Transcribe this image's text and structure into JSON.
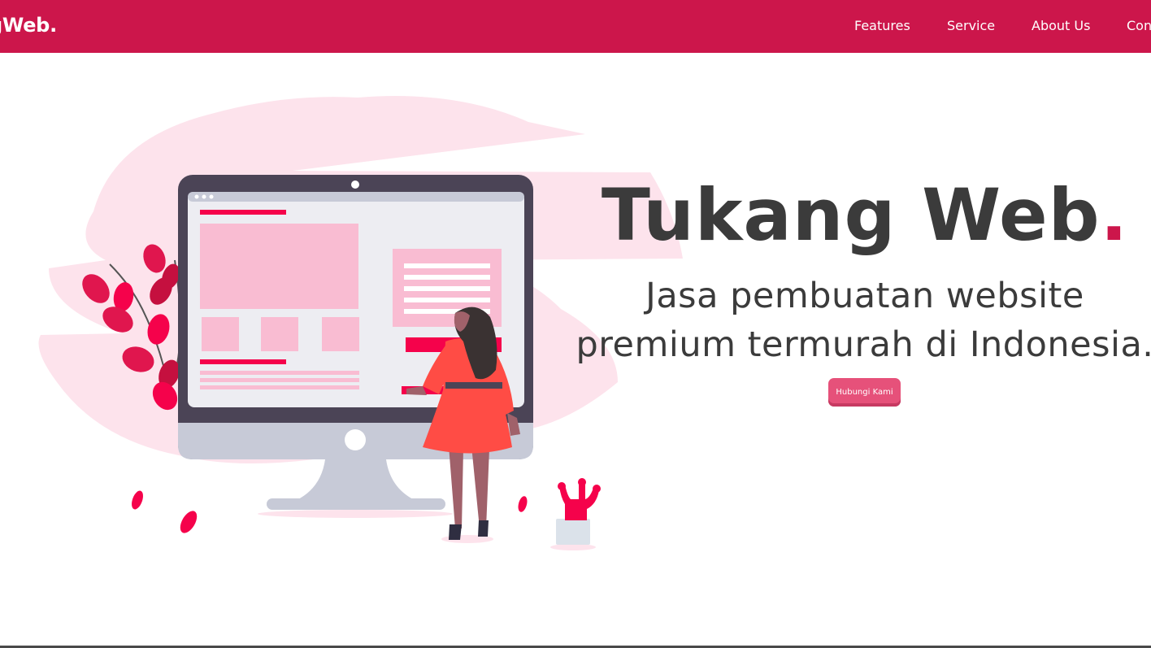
{
  "navbar": {
    "brand_text": "gWeb",
    "brand_dot": ".",
    "items": [
      {
        "label": "Features"
      },
      {
        "label": "Service"
      },
      {
        "label": "About Us"
      },
      {
        "label": "Cont"
      }
    ],
    "background": "#cc164b"
  },
  "hero": {
    "title_main": "Tukang Web",
    "title_dot": ".",
    "subtitle_line1": "Jasa pembuatan website",
    "subtitle_line2": "premium termurah di Indonesia.",
    "cta_label": "Hubungi Kami"
  },
  "colors": {
    "accent": "#cc164b",
    "button": "#e6517a",
    "text": "#3b3b3b",
    "illustration_pink": "#f9bcd2",
    "illustration_red": "#f5024b"
  },
  "icons": [
    "monitor-illustration",
    "woman-illustration",
    "plant-illustration",
    "cactus-illustration",
    "leaf-icon"
  ]
}
